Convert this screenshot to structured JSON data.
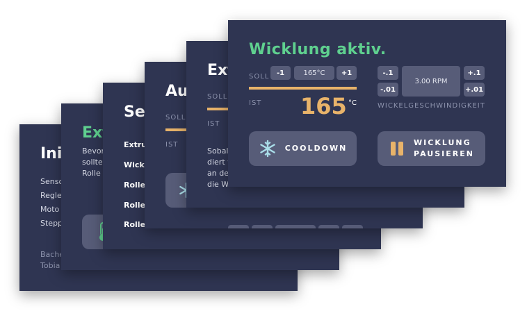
{
  "card1": {
    "title_partial": "Ini",
    "lines_partial": [
      "Senso",
      "Regle",
      "Moto",
      "Stepp"
    ],
    "footer_partial": [
      "Bache",
      "Tobia"
    ]
  },
  "card2": {
    "title_partial": "Ext",
    "lines_partial": [
      "Bevor",
      "sollter",
      "Rolle"
    ]
  },
  "card3": {
    "title_partial": "Set",
    "items_partial": [
      "Extru",
      "Wick",
      "Rolle",
      "Rolle",
      "Rolle"
    ]
  },
  "card4": {
    "title_partial": "Au",
    "soll_partial": "SOLL",
    "ist_partial": "IST"
  },
  "card5": {
    "title_partial": "Ext",
    "soll_partial": "SOLL",
    "ist_partial": "IST",
    "lines_partial": [
      "Sobal",
      "diert w",
      "an de",
      "die W"
    ]
  },
  "main": {
    "title": "Wicklung aktiv.",
    "soll_label": "SOLL",
    "ist_label": "IST",
    "temp_minus": "-1",
    "temp_value": "165°C",
    "temp_plus": "+1",
    "ist_value": "165",
    "ist_unit": "°C",
    "speed_minus_1": "-.1",
    "speed_minus_01": "-.01",
    "speed_value": "3.00 RPM",
    "speed_plus_1": "+.1",
    "speed_plus_01": "+.01",
    "speed_label": "WICKELGESCHWINDIGKEIT",
    "cooldown_label": "COOLDOWN",
    "pause_label_1": "WICKLUNG",
    "pause_label_2": "PAUSIEREN"
  },
  "colors": {
    "card_bg": "#2f3552",
    "button_bg": "#575c78",
    "accent_green": "#5fd08f",
    "accent_orange": "#e8b36a",
    "ice_blue": "#a9dde8"
  }
}
